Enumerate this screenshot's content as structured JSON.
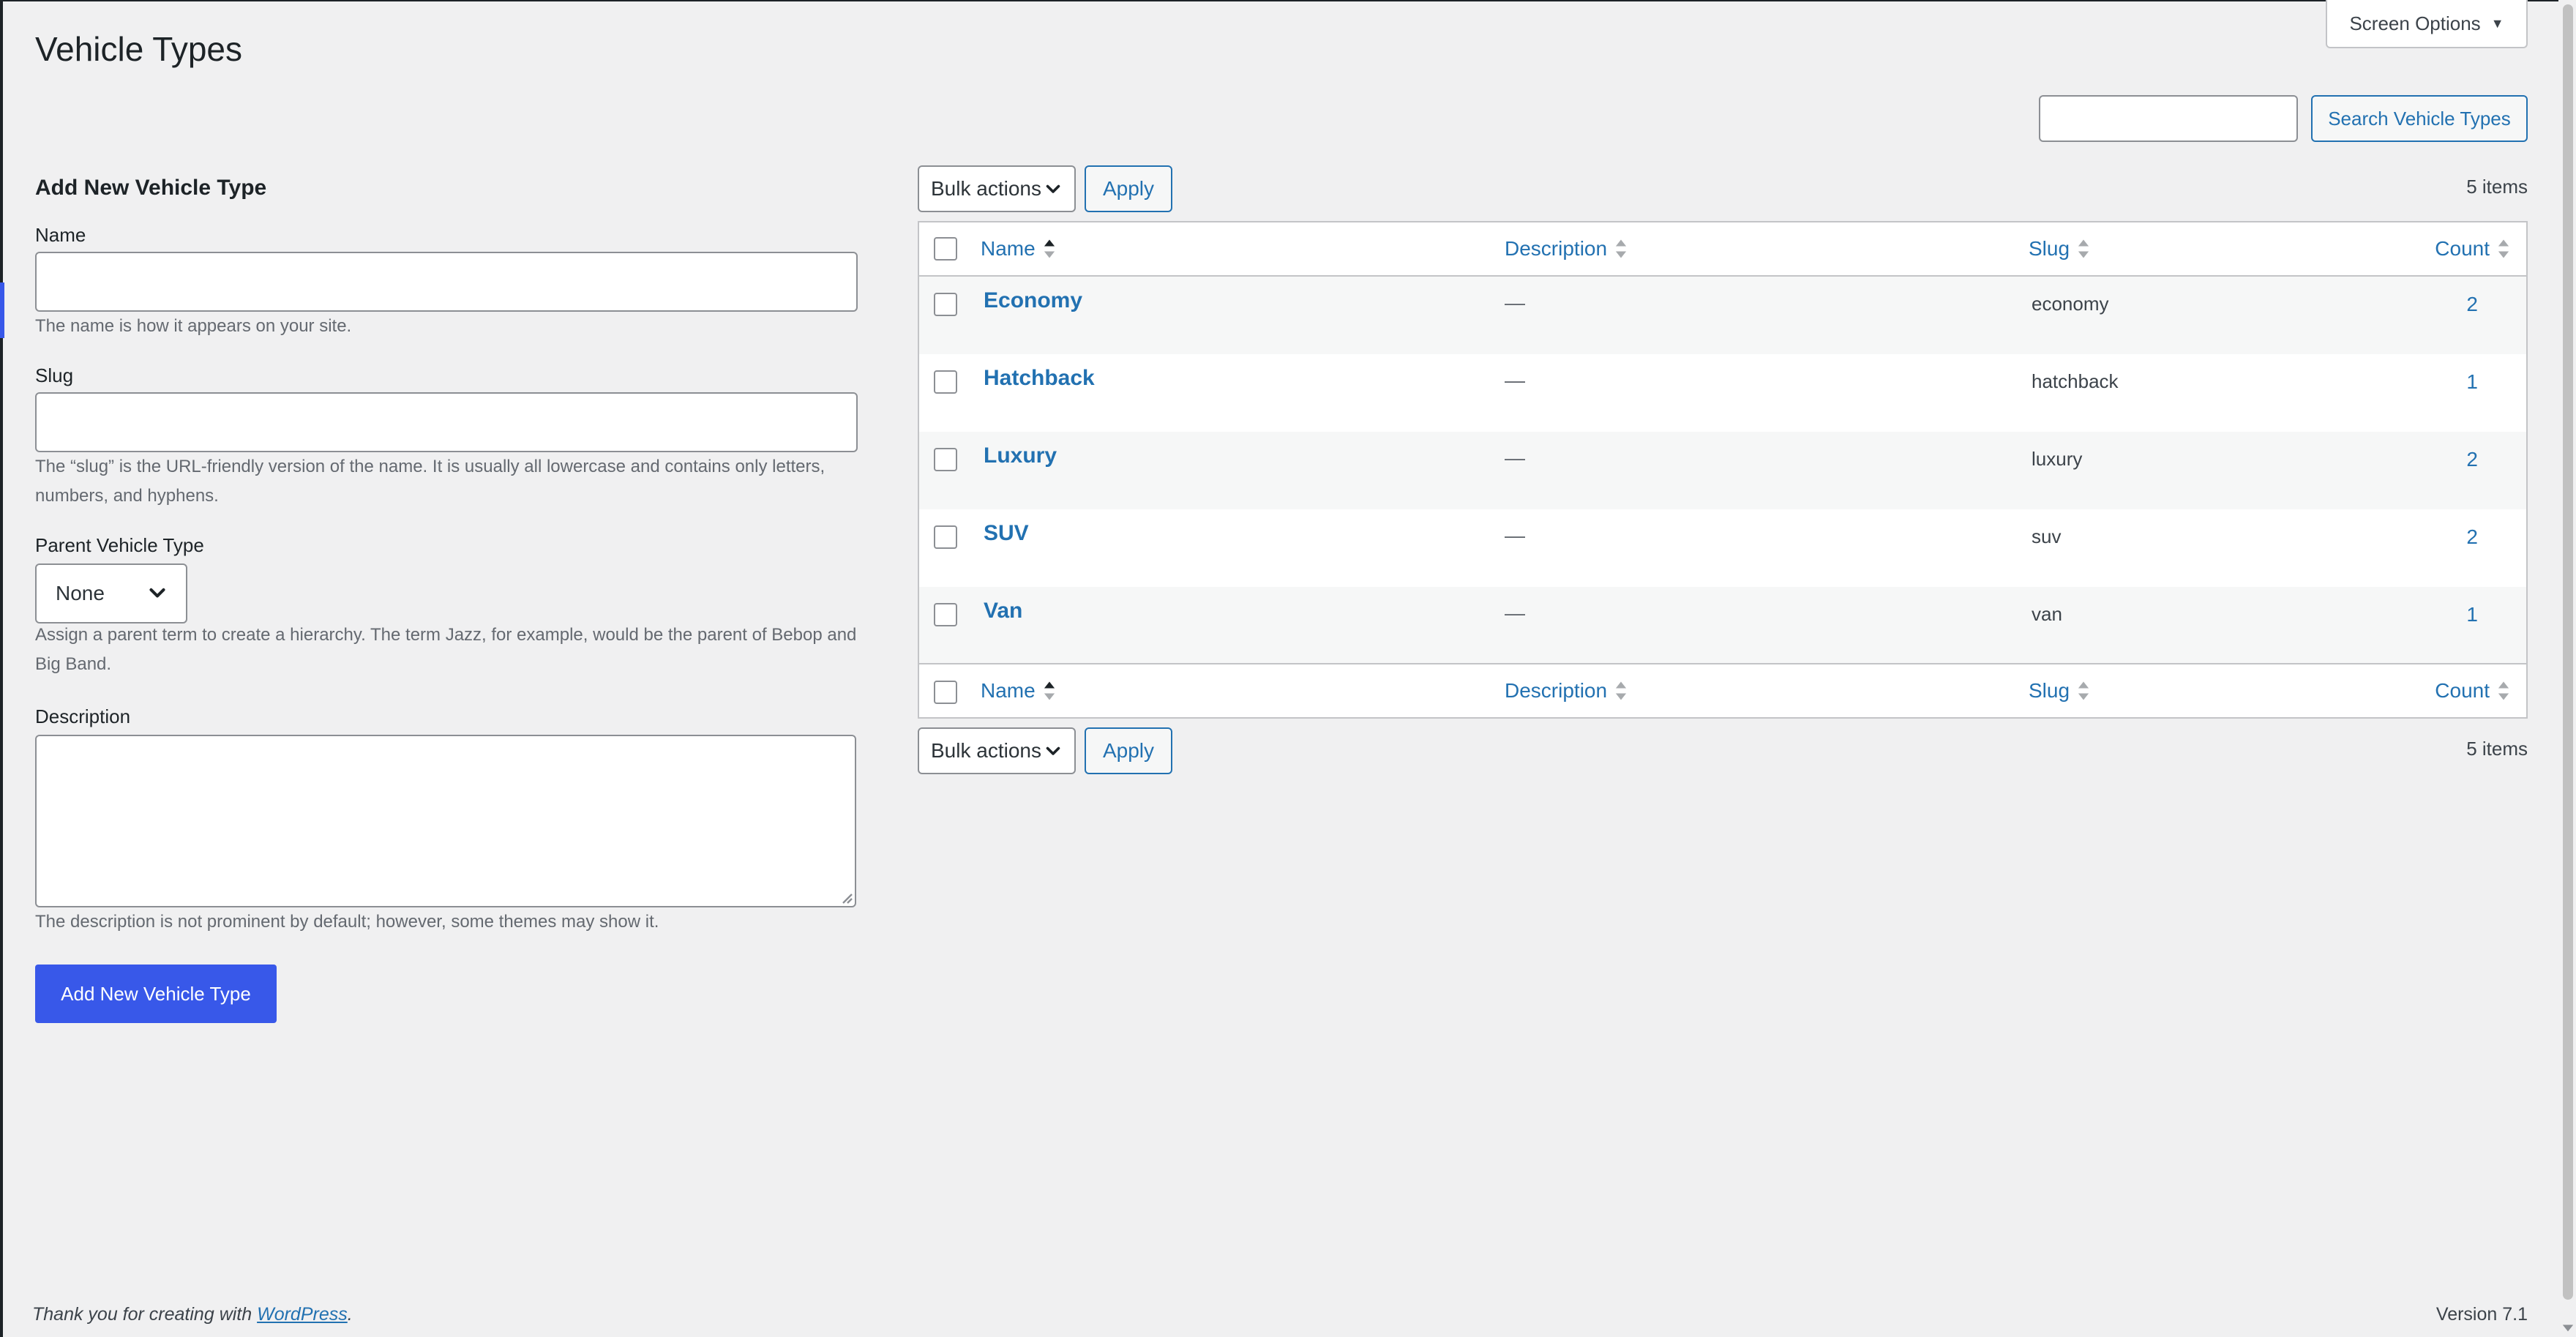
{
  "page": {
    "title": "Vehicle Types"
  },
  "screen_options": {
    "label": "Screen Options"
  },
  "search": {
    "button_label": "Search Vehicle Types",
    "value": ""
  },
  "form": {
    "heading": "Add New Vehicle Type",
    "name_label": "Name",
    "name_value": "",
    "name_help": "The name is how it appears on your site.",
    "slug_label": "Slug",
    "slug_value": "",
    "slug_help": "The “slug” is the URL-friendly version of the name. It is usually all lowercase and contains only letters, numbers, and hyphens.",
    "parent_label": "Parent Vehicle Type",
    "parent_value": "None",
    "parent_help": "Assign a parent term to create a hierarchy. The term Jazz, for example, would be the parent of Bebop and Big Band.",
    "description_label": "Description",
    "description_value": "",
    "description_help": "The description is not prominent by default; however, some themes may show it.",
    "submit_label": "Add New Vehicle Type"
  },
  "table_controls": {
    "bulk_actions_label": "Bulk actions",
    "apply_label": "Apply",
    "items_count": "5 items"
  },
  "table": {
    "columns": {
      "name": "Name",
      "description": "Description",
      "slug": "Slug",
      "count": "Count"
    },
    "rows": [
      {
        "name": "Economy",
        "description": "—",
        "slug": "economy",
        "count": "2"
      },
      {
        "name": "Hatchback",
        "description": "—",
        "slug": "hatchback",
        "count": "1"
      },
      {
        "name": "Luxury",
        "description": "—",
        "slug": "luxury",
        "count": "2"
      },
      {
        "name": "SUV",
        "description": "—",
        "slug": "suv",
        "count": "2"
      },
      {
        "name": "Van",
        "description": "—",
        "slug": "van",
        "count": "1"
      }
    ]
  },
  "footer": {
    "thanks_prefix": "Thank you for creating with ",
    "wordpress_link": "WordPress",
    "thanks_suffix": ".",
    "version": "Version 7.1"
  },
  "colors": {
    "accent": "#3858e9",
    "link": "#2271b1",
    "background": "#f0f0f1"
  }
}
